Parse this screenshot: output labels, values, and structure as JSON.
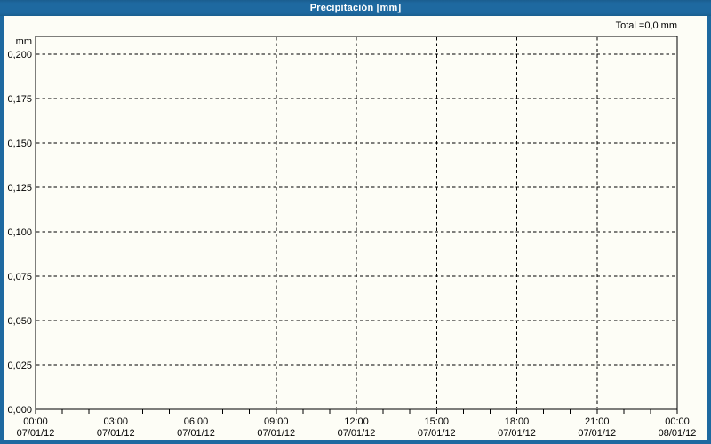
{
  "window": {
    "title": "Precipitación [mm]",
    "colors": {
      "accent_blue": "#1e69a0",
      "accent_blue_dark": "#14547e",
      "background": "#fdfdf6",
      "grid_line": "#000000",
      "title_text": "#ffffff"
    }
  },
  "chart_data": {
    "type": "bar",
    "title": "Precipitación [mm]",
    "total_annotation": "Total =0,0 mm",
    "ylabel": "mm",
    "ylim": [
      0,
      0.21
    ],
    "grid": true,
    "legend": false,
    "y_ticks": [
      {
        "label": "0,200",
        "value": 0.2
      },
      {
        "label": "0,175",
        "value": 0.175
      },
      {
        "label": "0,150",
        "value": 0.15
      },
      {
        "label": "0,125",
        "value": 0.125
      },
      {
        "label": "0,100",
        "value": 0.1
      },
      {
        "label": "0,075",
        "value": 0.075
      },
      {
        "label": "0,050",
        "value": 0.05
      },
      {
        "label": "0,025",
        "value": 0.025
      },
      {
        "label": "0,000",
        "value": 0.0
      }
    ],
    "x_ticks": [
      {
        "time": "00:00",
        "date": "07/01/12",
        "hour": 0
      },
      {
        "time": "03:00",
        "date": "07/01/12",
        "hour": 3
      },
      {
        "time": "06:00",
        "date": "07/01/12",
        "hour": 6
      },
      {
        "time": "09:00",
        "date": "07/01/12",
        "hour": 9
      },
      {
        "time": "12:00",
        "date": "07/01/12",
        "hour": 12
      },
      {
        "time": "15:00",
        "date": "07/01/12",
        "hour": 15
      },
      {
        "time": "18:00",
        "date": "07/01/12",
        "hour": 18
      },
      {
        "time": "21:00",
        "date": "07/01/12",
        "hour": 21
      },
      {
        "time": "00:00",
        "date": "08/01/12",
        "hour": 24
      }
    ],
    "minor_x_tick_interval_hours": 1,
    "series": [
      {
        "name": "Precipitación",
        "unit": "mm",
        "values": [],
        "total": 0.0
      }
    ]
  }
}
